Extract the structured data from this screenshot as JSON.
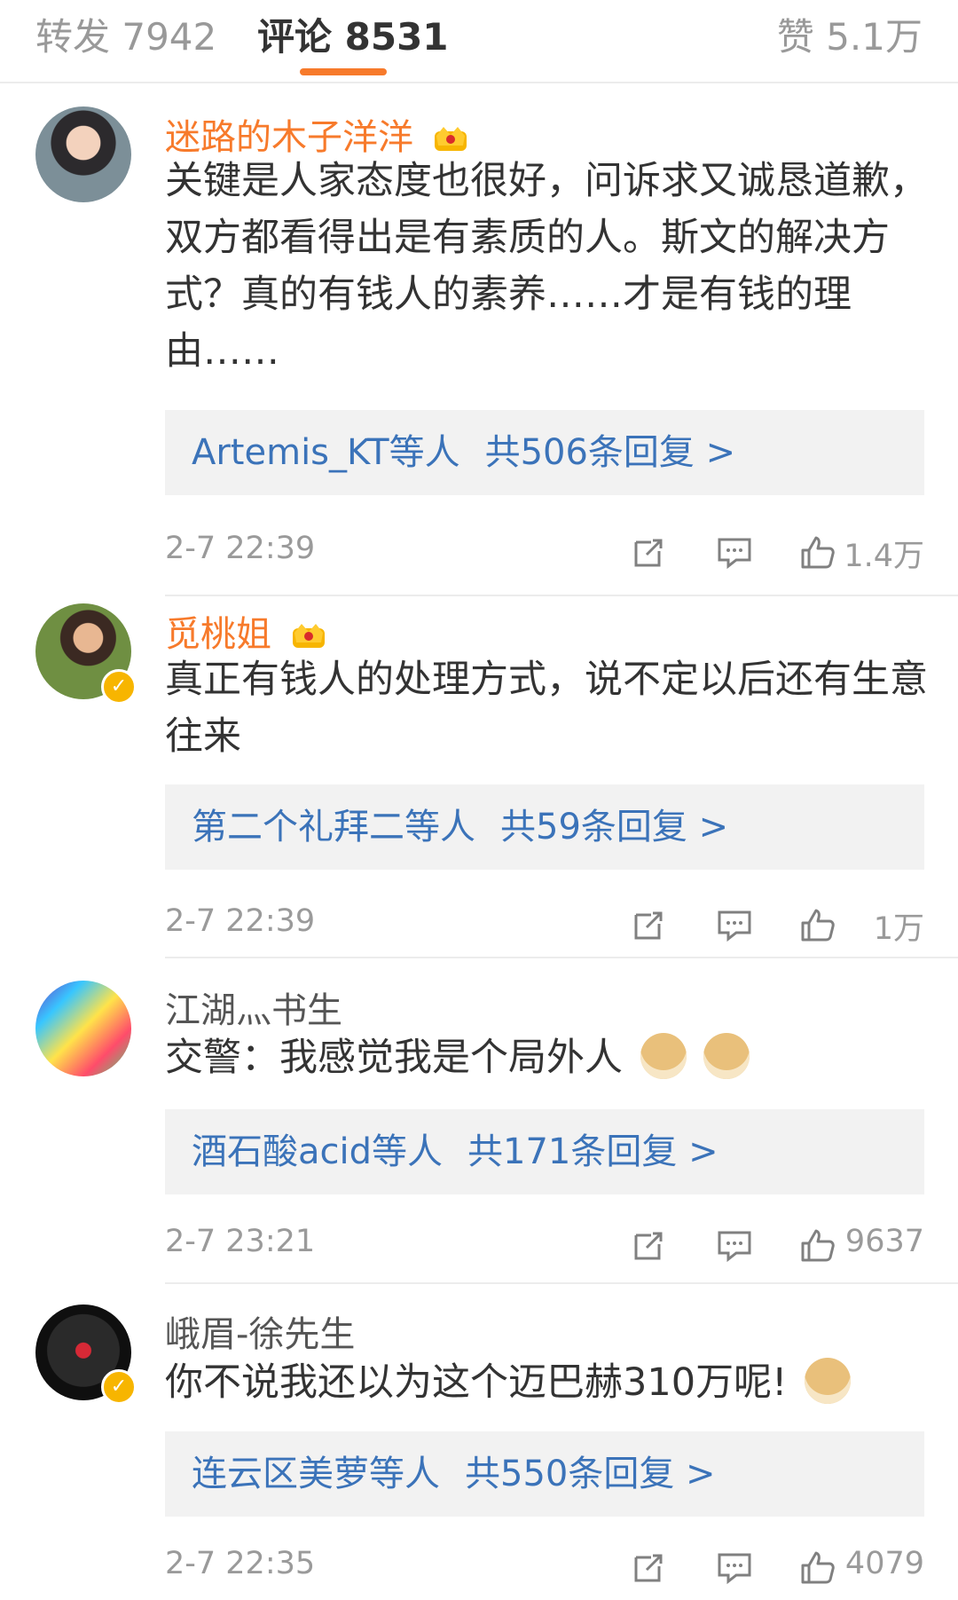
{
  "tabs": {
    "forward": "转发 7942",
    "comments": "评论 8531",
    "likes": "赞 5.1万"
  },
  "comments": [
    {
      "name": "迷路的木子洋洋",
      "text": "关键是人家态度也很好，问诉求又诚恳道歉，双方都看得出是有素质的人。斯文的解决方式？真的有钱人的素养……才是有钱的理由……",
      "reply_users": "Artemis_KT等人",
      "reply_count": "共506条回复 >",
      "time": "2-7 22:39",
      "likes": "1.4万"
    },
    {
      "name": "觅桃姐",
      "text": "真正有钱人的处理方式，说不定以后还有生意往来",
      "reply_users": "第二个礼拜二等人",
      "reply_count": "共59条回复 >",
      "time": "2-7 22:39",
      "likes": "1万"
    },
    {
      "name": "江湖灬书生",
      "text": "交警：我感觉我是个局外人",
      "reply_users": "酒石酸acid等人",
      "reply_count": "共171条回复 >",
      "time": "2-7 23:21",
      "likes": "9637"
    },
    {
      "name": "峨眉-徐先生",
      "text": "你不说我还以为这个迈巴赫310万呢!",
      "reply_users": "连云区美萝等人",
      "reply_count": "共550条回复 >",
      "time": "2-7 22:35",
      "likes": "4079"
    }
  ],
  "icons": {
    "verify": "✓"
  },
  "colors": {
    "accent": "#f77a2b",
    "link": "#3b73b9",
    "reply_box": "#f2f2f2"
  }
}
